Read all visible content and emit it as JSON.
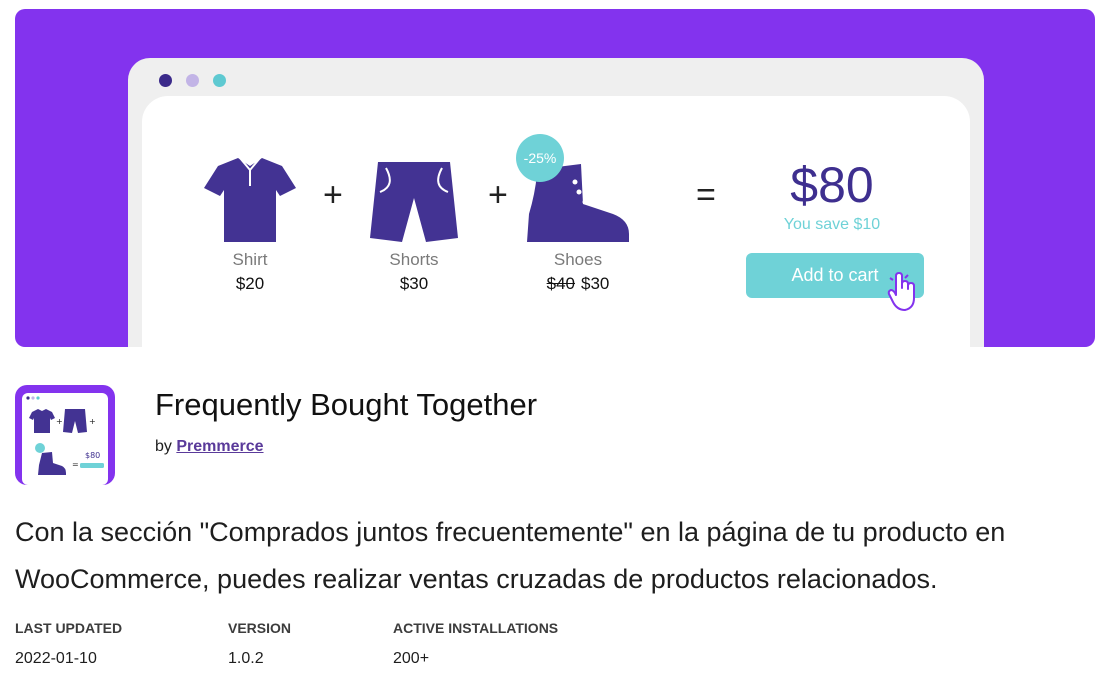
{
  "products": [
    {
      "name": "Shirt",
      "price": "$20",
      "icon": "shirt-icon"
    },
    {
      "name": "Shorts",
      "price": "$30",
      "icon": "shorts-icon"
    },
    {
      "name": "Shoes",
      "old_price": "$40",
      "price": "$30",
      "icon": "boot-icon"
    }
  ],
  "operators": {
    "plus": "+",
    "equals": "="
  },
  "discount_badge": "-25%",
  "total": {
    "amount": "$80",
    "savings": "You save $10"
  },
  "cart_button": "Add to cart",
  "plugin": {
    "title": "Frequently Bought Together",
    "by_prefix": "by",
    "author": "Premmerce",
    "description": "Con la sección \"Comprados juntos frecuentemente\" en la página de tu producto en WooCommerce, puedes realizar ventas cruzadas de productos relacionados."
  },
  "meta": [
    {
      "label": "LAST UPDATED",
      "value": "2022-01-10"
    },
    {
      "label": "VERSION",
      "value": "1.0.2"
    },
    {
      "label": "ACTIVE INSTALLATIONS",
      "value": "200+"
    }
  ],
  "colors": {
    "banner": "#8333EE",
    "accent": "#6fd2d7",
    "navy": "#3e2f8f"
  }
}
